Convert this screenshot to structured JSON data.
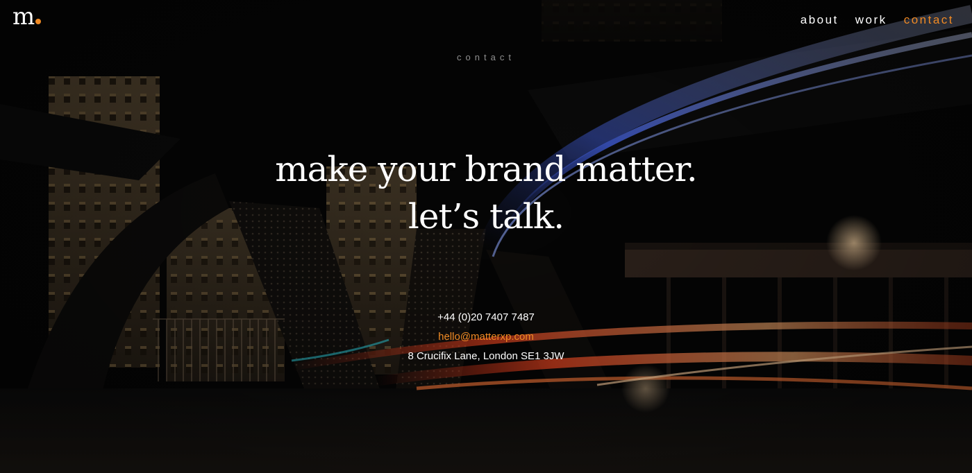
{
  "brand": {
    "logo_text": "m",
    "accent_color": "#f08a24"
  },
  "nav": {
    "items": [
      {
        "label": "about"
      },
      {
        "label": "work"
      },
      {
        "label": "contact"
      }
    ],
    "active": "contact"
  },
  "page_label": "contact",
  "hero": {
    "line1": "make your brand matter.",
    "line2": "let’s talk."
  },
  "contact": {
    "phone": "+44 (0)20 7407 7487",
    "email": "hello@matterxp.com",
    "address": "8 Crucifix Lane, London SE1 3JW"
  }
}
